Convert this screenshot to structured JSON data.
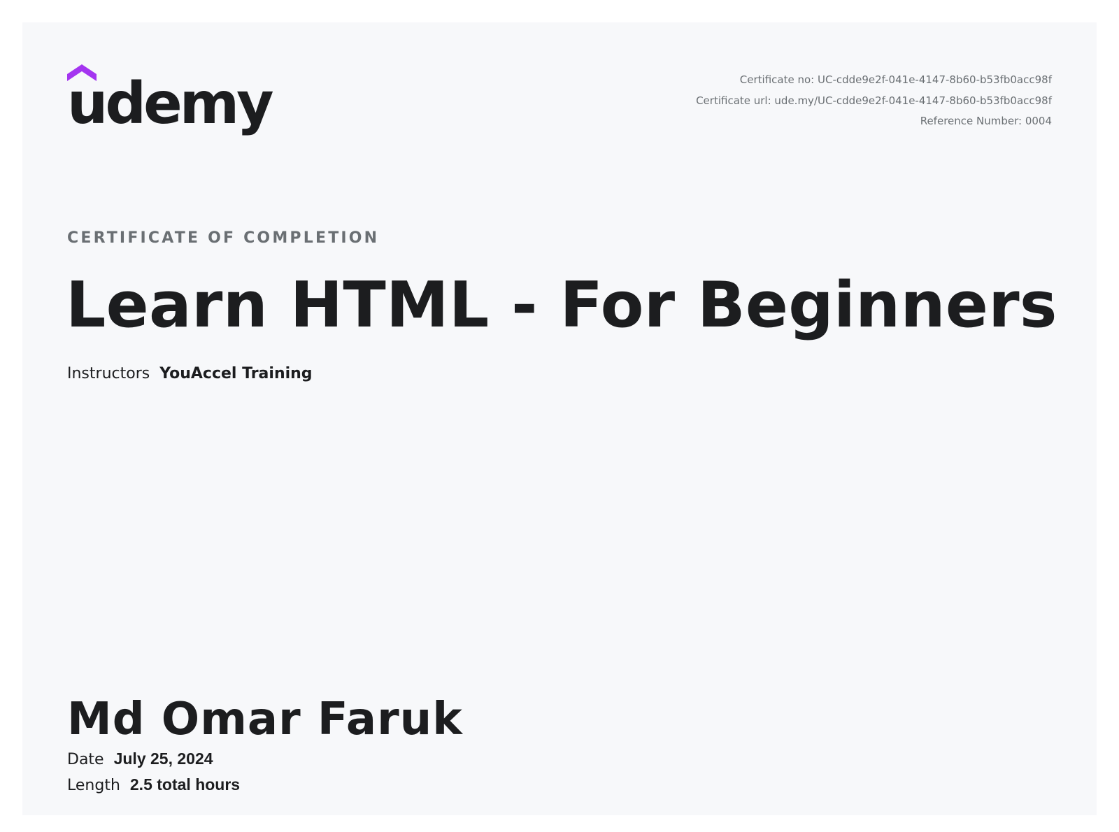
{
  "logo": {
    "wordmark": "udemy",
    "icon": "udemy-chevron-icon",
    "accent_color": "#a435f0"
  },
  "certificate_meta": {
    "certificate_no": "Certificate no: UC-cdde9e2f-041e-4147-8b60-b53fb0acc98f",
    "certificate_url": "Certificate url: ude.my/UC-cdde9e2f-041e-4147-8b60-b53fb0acc98f",
    "reference_number": "Reference Number: 0004"
  },
  "heading": "CERTIFICATE OF COMPLETION",
  "course_title": "Learn HTML - For Beginners",
  "instructors": {
    "label": "Instructors",
    "value": "YouAccel Training"
  },
  "recipient_name": "Md Omar Faruk",
  "date": {
    "label": "Date",
    "value": "July 25, 2024"
  },
  "length": {
    "label": "Length",
    "value": "2.5 total hours"
  }
}
